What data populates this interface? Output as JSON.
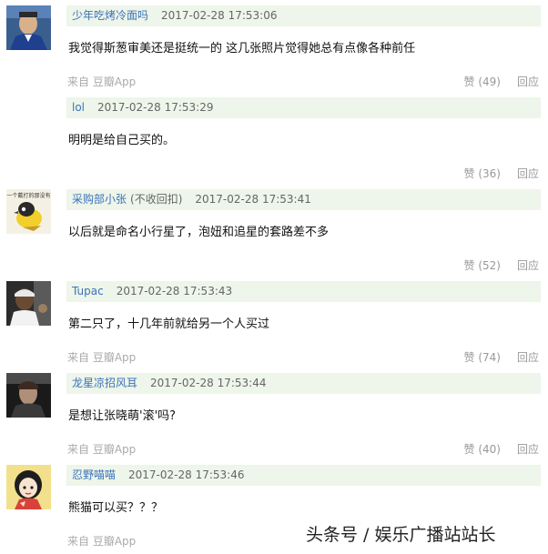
{
  "comments": [
    {
      "author": "少年吃烤冷面吗",
      "author_note": "",
      "time": "2017-02-28 17:53:06",
      "text": "我觉得斯葱审美还是挺统一的 这几张照片觉得她总有点像各种前任",
      "source": "来自 豆瓣App",
      "likes": "赞 (49)",
      "reply": "回应",
      "avatar": "man-in-blue-suit"
    },
    {
      "author": "lol",
      "author_note": "",
      "time": "2017-02-28 17:53:29",
      "text": "明明是给自己买的。",
      "source": "",
      "likes": "赞 (36)",
      "reply": "回应",
      "avatar": ""
    },
    {
      "author": "采购部小张",
      "author_note": "(不收回扣)",
      "time": "2017-02-28 17:53:41",
      "text": "以后就是命名小行星了，泡妞和追星的套路差不多",
      "source": "",
      "likes": "赞 (52)",
      "reply": "回应",
      "avatar": "yellow-bird",
      "avatar_caption": "一个戴打的那没有"
    },
    {
      "author": "Tupac",
      "author_note": "",
      "time": "2017-02-28 17:53:43",
      "text": "第二只了，十几年前就给另一个人买过",
      "source": "来自 豆瓣App",
      "likes": "赞 (74)",
      "reply": "回应",
      "avatar": "man-in-bandana"
    },
    {
      "author": "龙星凉招风耳",
      "author_note": "",
      "time": "2017-02-28 17:53:44",
      "text": "是想让张晓萌'滚'吗?",
      "source": "来自 豆瓣App",
      "likes": "赞 (40)",
      "reply": "回应",
      "avatar": "man-portrait-dark"
    },
    {
      "author": "忍野喵喵",
      "author_note": "",
      "time": "2017-02-28 17:53:46",
      "text": "熊猫可以买？？？",
      "source": "来自 豆瓣App",
      "likes": "",
      "reply": "",
      "avatar": "cartoon-girl"
    }
  ],
  "watermark": "头条号 / 娱乐广播站站长",
  "colors": {
    "header_bg": "#eef5ea",
    "author_link": "#3b73b9",
    "meta": "#999999"
  }
}
